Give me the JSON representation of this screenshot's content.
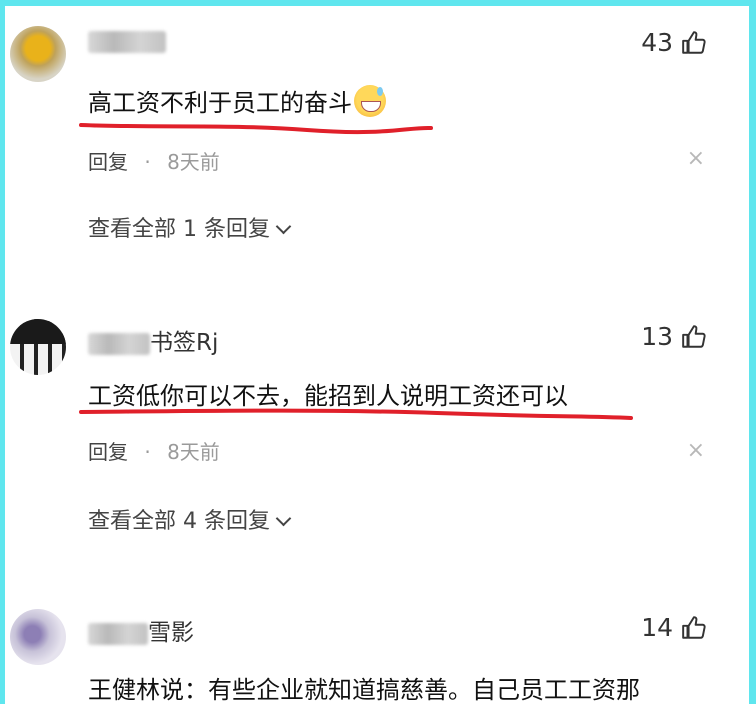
{
  "comments": [
    {
      "name_visible": "",
      "likes": "43",
      "text": "高工资不利于员工的奋斗",
      "reply_label": "回复",
      "dot": "·",
      "time": "8天前",
      "view_replies": "查看全部 1 条回复",
      "close": "×"
    },
    {
      "name_visible": "书签Rj",
      "likes": "13",
      "text": "工资低你可以不去，能招到人说明工资还可以",
      "reply_label": "回复",
      "dot": "·",
      "time": "8天前",
      "view_replies": "查看全部 4 条回复",
      "close": "×"
    },
    {
      "name_visible": "雪影",
      "likes": "14",
      "text": "王健林说：有些企业就知道搞慈善。自己员工工资那"
    }
  ],
  "colors": {
    "frame": "#5fe6ee",
    "underline": "#e0202a"
  },
  "icons": {
    "like": "thumbs-up-icon",
    "close": "close-icon",
    "expand": "chevron-down-icon"
  }
}
